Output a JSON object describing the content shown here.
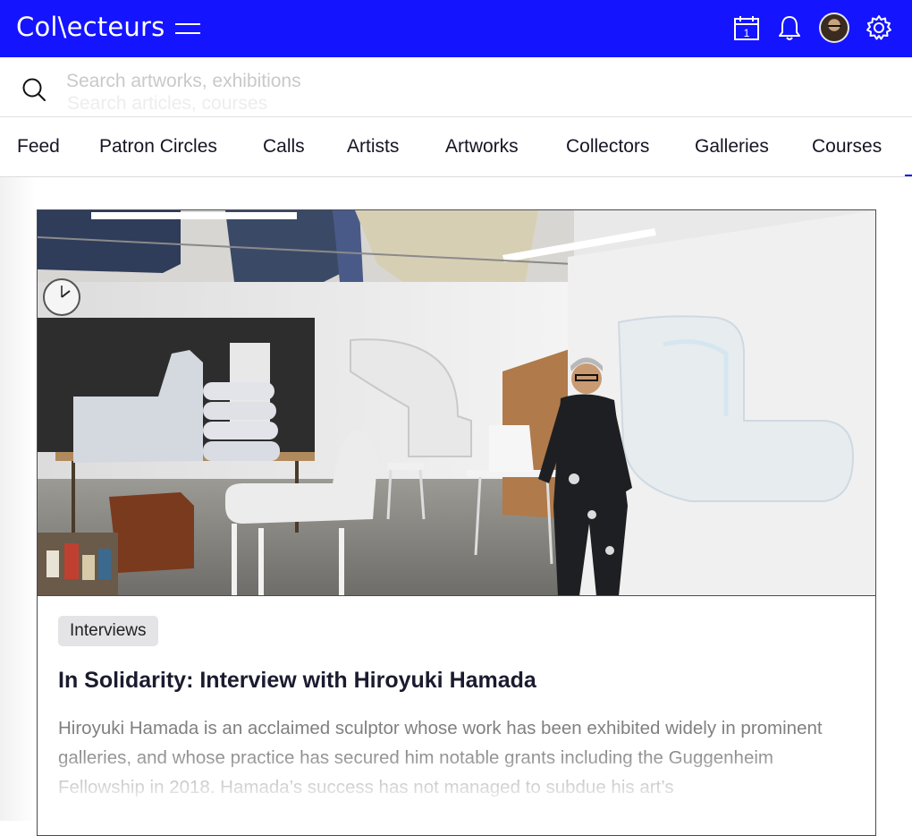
{
  "header": {
    "logo": "Col\\ecteurs",
    "calendar_day": "1",
    "brand_color": "#1414ff"
  },
  "search": {
    "placeholder": "Search artworks, exhibitions",
    "secondary_placeholder": "Search articles, courses"
  },
  "nav": {
    "items": [
      {
        "label": "Feed"
      },
      {
        "label": "Patron Circles"
      },
      {
        "label": "Calls"
      },
      {
        "label": "Artists"
      },
      {
        "label": "Artworks"
      },
      {
        "label": "Collectors"
      },
      {
        "label": "Galleries"
      },
      {
        "label": "Courses"
      }
    ]
  },
  "article": {
    "tag": "Interviews",
    "title": "In Solidarity: Interview with Hiroyuki Hamada",
    "excerpt": "Hiroyuki Hamada is an acclaimed sculptor whose work has been exhibited widely in prominent galleries, and whose practice has secured him notable grants including the Guggenheim Fellowship in 2018. Hamada’s success has not managed to subdue his art’s"
  },
  "icons": {
    "calendar": "calendar-icon",
    "notifications": "bell-icon",
    "settings": "gear-icon",
    "search": "search-icon",
    "menu": "hamburger-icon"
  }
}
